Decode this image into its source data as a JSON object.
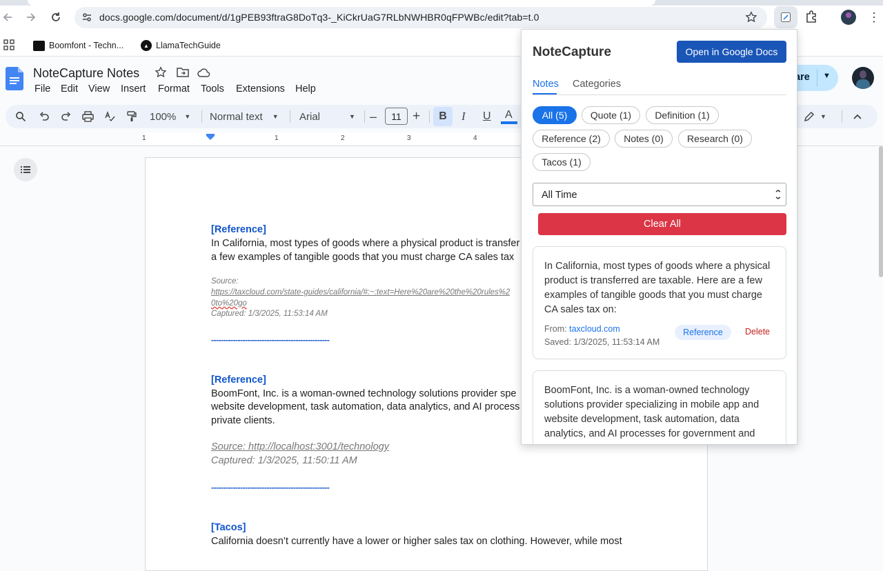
{
  "browser": {
    "url": "docs.google.com/document/d/1gPEB93ftraG8DoTq3-_KiCkrUaG7RLbNWHBR0qFPWBc/edit?tab=t.0",
    "bookmarks": [
      {
        "label": "Boomfont - Techn..."
      },
      {
        "label": "LlamaTechGuide"
      }
    ]
  },
  "docs": {
    "title": "NoteCapture Notes",
    "menu": [
      "File",
      "Edit",
      "View",
      "Insert",
      "Format",
      "Tools",
      "Extensions",
      "Help"
    ],
    "toolbar": {
      "zoom": "100%",
      "style": "Normal text",
      "font": "Arial",
      "font_size": "11",
      "bold": "B",
      "italic": "I",
      "underline": "U",
      "text_color": "A"
    },
    "share_label": "are",
    "ruler_numbers": [
      "1",
      "1",
      "2",
      "3",
      "4"
    ],
    "content": {
      "tag1": "[Reference]",
      "p1_line1": "In California, most types of goods where a physical product is transfer",
      "p1_line2": "a few examples of tangible goods that you must charge CA sales tax",
      "src1_label": "Source:",
      "src1_url1": "https://taxcloud.com/state-guides/california/#:~:text=Here%20are%20the%20rules%2",
      "src1_url2": "0to%20go",
      "captured1": "Captured: 1/3/2025, 11:53:14 AM",
      "divider1": "-------------------------------------------------",
      "tag2": "[Reference]",
      "p2_line1": "BoomFont, Inc. is a woman-owned technology solutions provider spe",
      "p2_line2": "website development, task automation, data analytics, and AI process",
      "p2_line3": "private clients.",
      "src2": "Source: http://localhost:3001/technology",
      "captured2": "Captured: 1/3/2025, 11:50:11 AM",
      "divider2": "-------------------------------------------------",
      "tag3": "[Tacos]",
      "p3_line1": "California doesn’t currently have a lower or higher sales tax on clothing. However, while most"
    }
  },
  "popup": {
    "title": "NoteCapture",
    "open_button": "Open in Google Docs",
    "tabs": [
      "Notes",
      "Categories"
    ],
    "chips": [
      "All (5)",
      "Quote (1)",
      "Definition (1)",
      "Reference (2)",
      "Notes (0)",
      "Research (0)",
      "Tacos (1)"
    ],
    "time_filter": "All Time",
    "clear_button": "Clear All",
    "notes": [
      {
        "lines": [
          "In California, most types of goods where a physical",
          "product is transferred are taxable. Here are a few",
          "examples of tangible goods that you must charge",
          "CA sales tax on:"
        ],
        "from_label": "From:",
        "from_domain": "taxcloud.com",
        "saved": "Saved: 1/3/2025, 11:53:14 AM",
        "category": "Reference",
        "delete": "Delete"
      },
      {
        "lines": [
          "BoomFont, Inc. is a woman-owned technology",
          "solutions provider specializing in mobile app and",
          "website development, task automation, data",
          "analytics, and AI processes for government and"
        ]
      }
    ]
  },
  "colors": {
    "accent": "#1a73e8",
    "open_button": "#1a56b8",
    "clear_button": "#dc3545",
    "doc_tag": "#1155cc",
    "delete": "#c5221f"
  }
}
